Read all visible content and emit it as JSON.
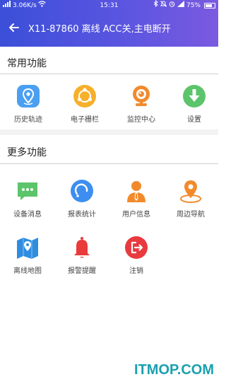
{
  "status": {
    "network": "3.06K/s",
    "time": "15:31",
    "battery": "75%"
  },
  "header": {
    "title": "X11-87860 离线 ACC关,主电断开"
  },
  "sections": {
    "common": {
      "title": "常用功能",
      "items": [
        {
          "label": "历史轨迹",
          "icon": "location-track-icon"
        },
        {
          "label": "电子栅栏",
          "icon": "fence-icon"
        },
        {
          "label": "监控中心",
          "icon": "camera-icon"
        },
        {
          "label": "设置",
          "icon": "download-icon"
        }
      ]
    },
    "more": {
      "title": "更多功能",
      "items": [
        {
          "label": "设备消息",
          "icon": "message-icon"
        },
        {
          "label": "报表统计",
          "icon": "report-icon"
        },
        {
          "label": "用户信息",
          "icon": "user-icon"
        },
        {
          "label": "周边导航",
          "icon": "nearby-navigation-icon"
        },
        {
          "label": "离线地图",
          "icon": "offline-map-icon"
        },
        {
          "label": "报警提醒",
          "icon": "alarm-bell-icon"
        },
        {
          "label": "注销",
          "icon": "logout-icon"
        }
      ]
    }
  },
  "watermark": "ITMOP.COM"
}
